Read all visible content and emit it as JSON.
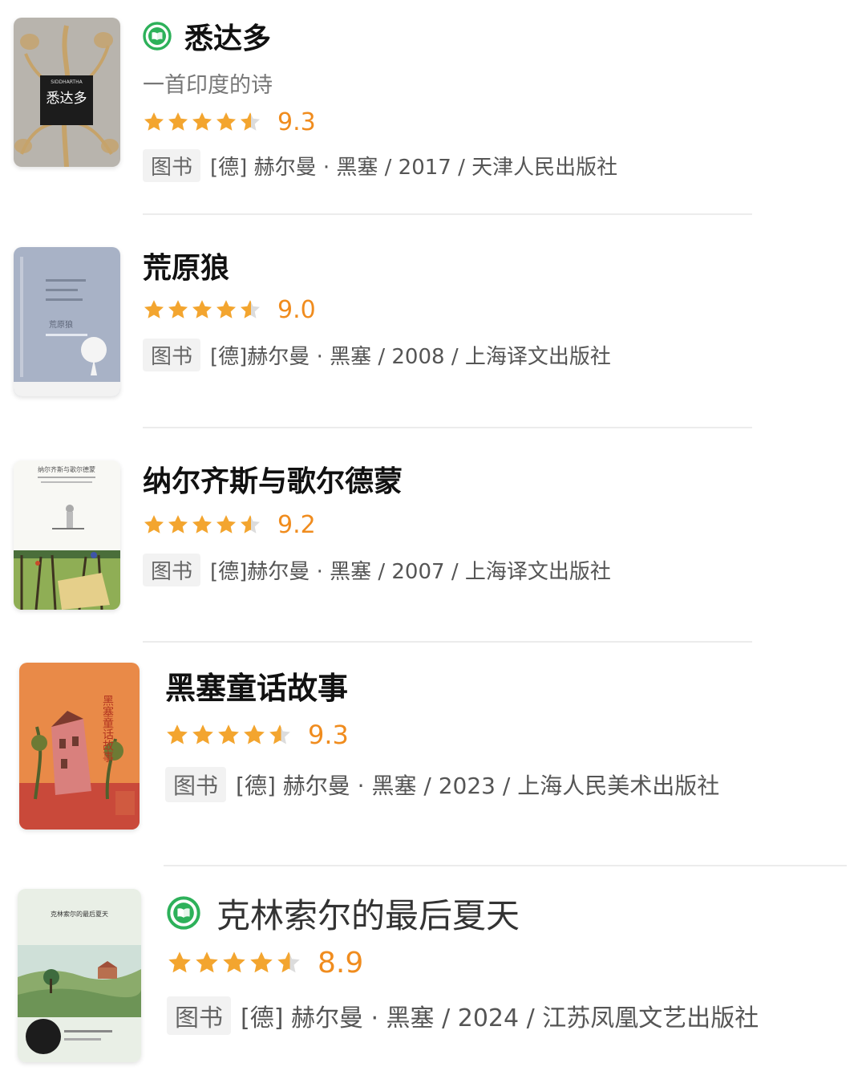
{
  "books": [
    {
      "title": "悉达多",
      "subtitle": "一首印度的诗",
      "has_read_badge": true,
      "rating": 9.3,
      "rating_text": "9.3",
      "tag": "图书",
      "meta": "[德] 赫尔曼 · 黑塞 / 2017 / 天津人民出版社",
      "cover": {
        "en_title": "SIDDHARTHA",
        "cn_title": "悉达多",
        "bg": "#b8b4ad",
        "accent": "#c6a36a"
      }
    },
    {
      "title": "荒原狼",
      "has_read_badge": false,
      "rating": 9.0,
      "rating_text": "9.0",
      "tag": "图书",
      "meta": "[德]赫尔曼 · 黑塞 / 2008 / 上海译文出版社",
      "cover": {
        "cn_title": "荒原狼",
        "bg": "#a8b2c6"
      }
    },
    {
      "title": "纳尔齐斯与歌尔德蒙",
      "has_read_badge": false,
      "rating": 9.2,
      "rating_text": "9.2",
      "tag": "图书",
      "meta": "[德]赫尔曼 · 黑塞 / 2007 / 上海译文出版社",
      "cover": {
        "cn_title": "纳尔齐斯与歌尔德蒙",
        "bg": "#f8f8f4"
      }
    },
    {
      "title": "黑塞童话故事",
      "has_read_badge": false,
      "rating": 9.3,
      "rating_text": "9.3",
      "tag": "图书",
      "meta": "[德] 赫尔曼 · 黑塞 / 2023 / 上海人民美术出版社",
      "cover": {
        "cn_title": "黑塞童话故事",
        "bg": "#e98a48"
      }
    },
    {
      "title": "克林索尔的最后夏天",
      "has_read_badge": true,
      "rating": 8.9,
      "rating_text": "8.9",
      "tag": "图书",
      "meta": "[德] 赫尔曼 · 黑塞 / 2024 / 江苏凤凰文艺出版社",
      "cover": {
        "cn_title": "克林索尔的最后夏天",
        "bg": "#e9efe6"
      }
    }
  ],
  "colors": {
    "star": "#f3a52f",
    "star_empty": "#dcdcdc",
    "score": "#f08c1e",
    "badge": "#2db15a"
  },
  "icons": {
    "read_badge": "book-read-icon",
    "star": "star-icon"
  }
}
